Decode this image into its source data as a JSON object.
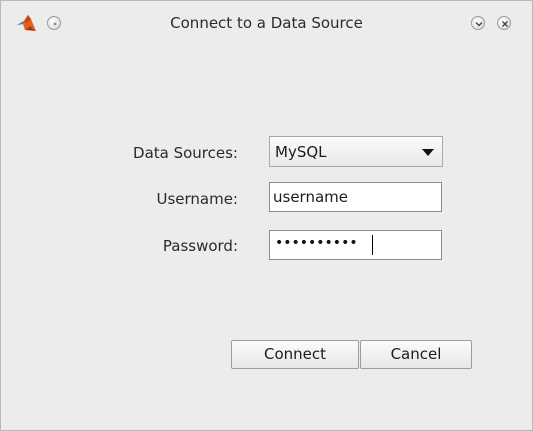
{
  "window": {
    "title": "Connect to a Data Source",
    "icons": {
      "app": "matlab-logo-icon",
      "minimize": "minimize-circle-icon",
      "menu": "chevron-down-icon",
      "close": "close-icon"
    }
  },
  "form": {
    "data_sources_label": "Data Sources:",
    "data_sources_value": "MySQL",
    "username_label": "Username:",
    "username_value": "username",
    "password_label": "Password:",
    "password_mask": "••••••••••"
  },
  "buttons": {
    "connect_label": "Connect",
    "cancel_label": "Cancel"
  }
}
